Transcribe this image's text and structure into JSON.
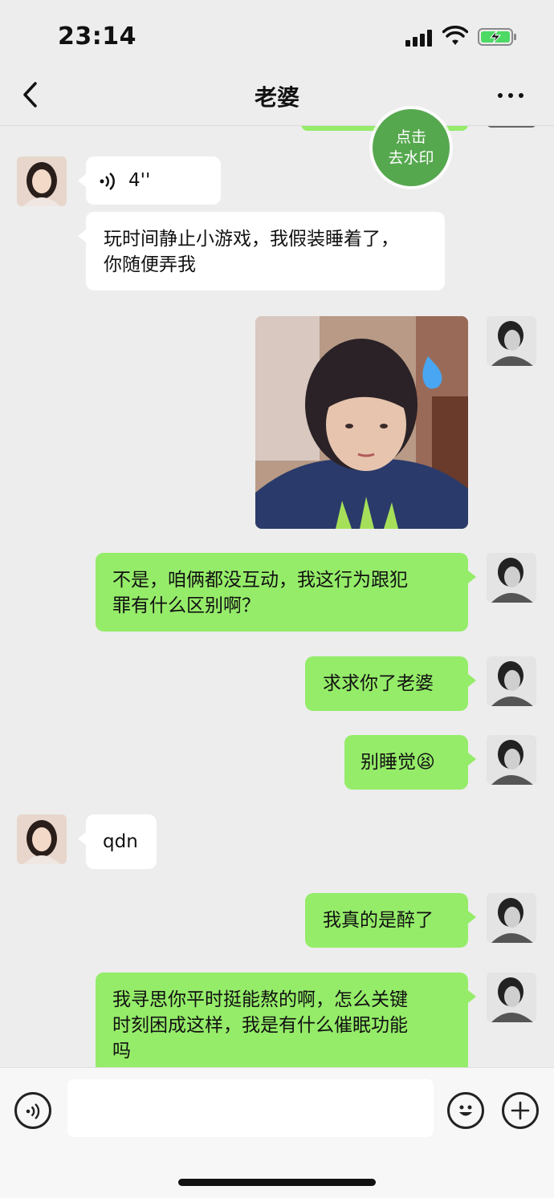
{
  "status": {
    "time": "23:14"
  },
  "nav": {
    "title": "老婆"
  },
  "watermark_button": {
    "line1": "点击",
    "line2": "去水印"
  },
  "messages": [
    {
      "side": "left",
      "type": "voice",
      "duration": "4''"
    },
    {
      "side": "left",
      "type": "text",
      "lines": [
        "玩时间静止小游戏，我假装睡着了，",
        "你随便弄我"
      ]
    },
    {
      "side": "right",
      "type": "image"
    },
    {
      "side": "right",
      "type": "text",
      "lines": [
        "不是，咱俩都没互动，我这行为跟犯",
        "罪有什么区别啊？"
      ]
    },
    {
      "side": "right",
      "type": "text",
      "lines": [
        "求求你了老婆"
      ]
    },
    {
      "side": "right",
      "type": "text",
      "lines": [
        "别睡觉😫"
      ]
    },
    {
      "side": "left",
      "type": "text",
      "lines": [
        "qdn"
      ]
    },
    {
      "side": "right",
      "type": "text",
      "lines": [
        "我真的是醉了"
      ]
    },
    {
      "side": "right",
      "type": "text",
      "lines": [
        "我寻思你平时挺能熬的啊，怎么关键",
        "时刻困成这样，我是有什么催眠功能",
        "吗"
      ]
    }
  ],
  "colors": {
    "self_bubble": "#95ec69",
    "other_bubble": "#ffffff",
    "background": "#ededed",
    "watermark_green": "#56a84e"
  },
  "icons": [
    "back-arrow-icon",
    "more-dots-icon",
    "voice-icon",
    "emoji-icon",
    "plus-icon"
  ]
}
